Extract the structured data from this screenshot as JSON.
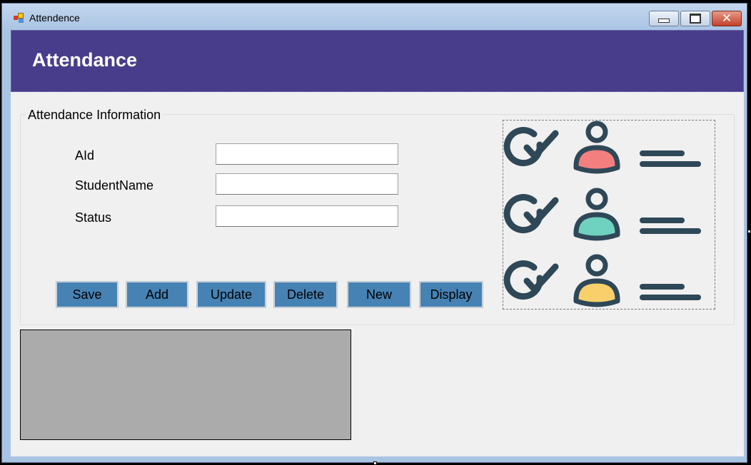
{
  "window": {
    "title": "Attendence",
    "icon": "app-form-icon",
    "controls": {
      "minimize_icon": "minimize-icon",
      "maximize_icon": "maximize-icon",
      "close_icon": "close-icon",
      "close_glyph": "✕"
    }
  },
  "header": {
    "title": "Attendance",
    "background_color": "#483d8b",
    "text_color": "#ffffff"
  },
  "group": {
    "legend": "Attendance Information"
  },
  "fields": [
    {
      "label": "AId",
      "value": "",
      "placeholder": ""
    },
    {
      "label": "StudentName",
      "value": "",
      "placeholder": ""
    },
    {
      "label": "Status",
      "value": "",
      "placeholder": ""
    }
  ],
  "buttons": {
    "save": "Save",
    "add": "Add",
    "update": "Update",
    "delete": "Delete",
    "new": "New",
    "display": "Display",
    "color": "#4682b4"
  },
  "illustration": {
    "icon": "attendance-checklist-icon",
    "rows": [
      {
        "check_icon": "check-circle-icon",
        "person_icon": "person-icon",
        "line_icon": "lines-icon",
        "body_color": "#f47f7f"
      },
      {
        "check_icon": "check-circle-icon",
        "person_icon": "person-icon",
        "line_icon": "lines-icon",
        "body_color": "#6fd1c0"
      },
      {
        "check_icon": "check-circle-icon",
        "person_icon": "person-icon",
        "line_icon": "lines-icon",
        "body_color": "#f9cf6b"
      }
    ],
    "stroke_color": "#2f4858"
  },
  "grid": {
    "background_color": "#ababab"
  }
}
